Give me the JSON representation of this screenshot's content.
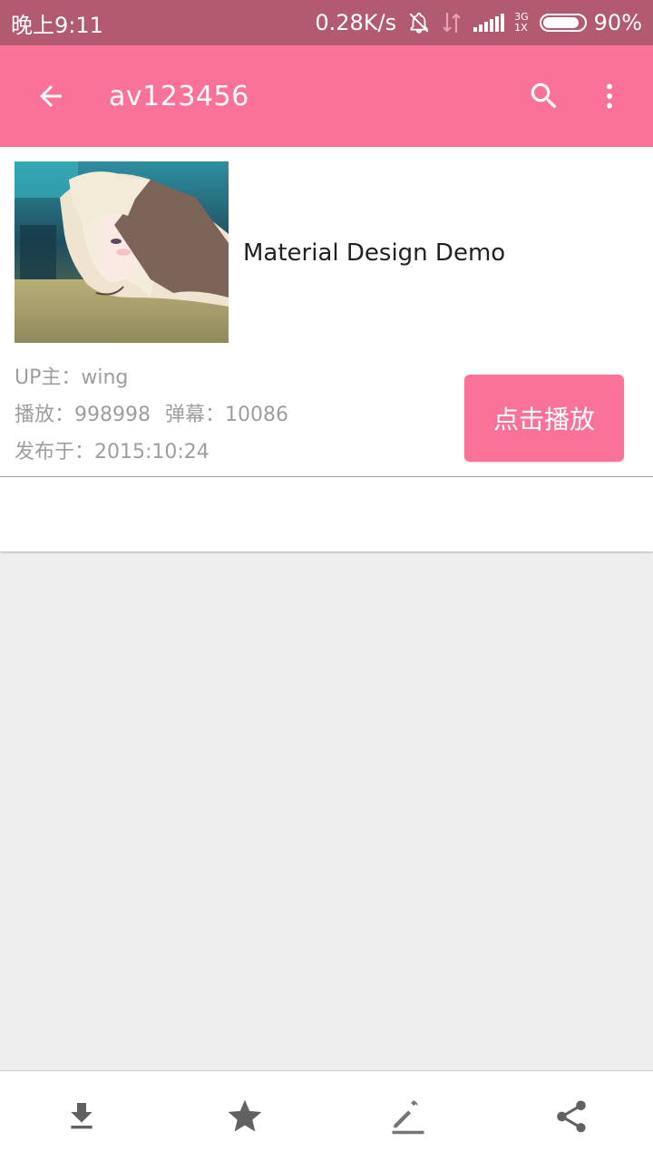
{
  "status_bar": {
    "time": "晚上9:11",
    "net_speed": "0.28K/s",
    "net_type_top": "3G",
    "net_type_bottom": "1X",
    "battery_percent": "90%",
    "battery_level": 0.9
  },
  "app_bar": {
    "title": "av123456",
    "icons": [
      "back-arrow-icon",
      "search-icon",
      "more-vert-icon"
    ],
    "color": "#fb7299"
  },
  "video": {
    "title": "Material Design Demo",
    "uploader": "UP主：wing",
    "plays_label": "播放：998998",
    "danmaku_label": "弹幕：10086",
    "publish_date": "发布于：2015:10:24",
    "play_button_label": "点击播放"
  },
  "bottom_bar": {
    "icons": [
      "download-icon",
      "star-icon",
      "edit-icon",
      "share-icon"
    ]
  },
  "colors": {
    "accent": "#fb7299",
    "status_bar": "#b15a70",
    "background": "#eeeeee",
    "secondary_text": "#9e9e9e"
  }
}
